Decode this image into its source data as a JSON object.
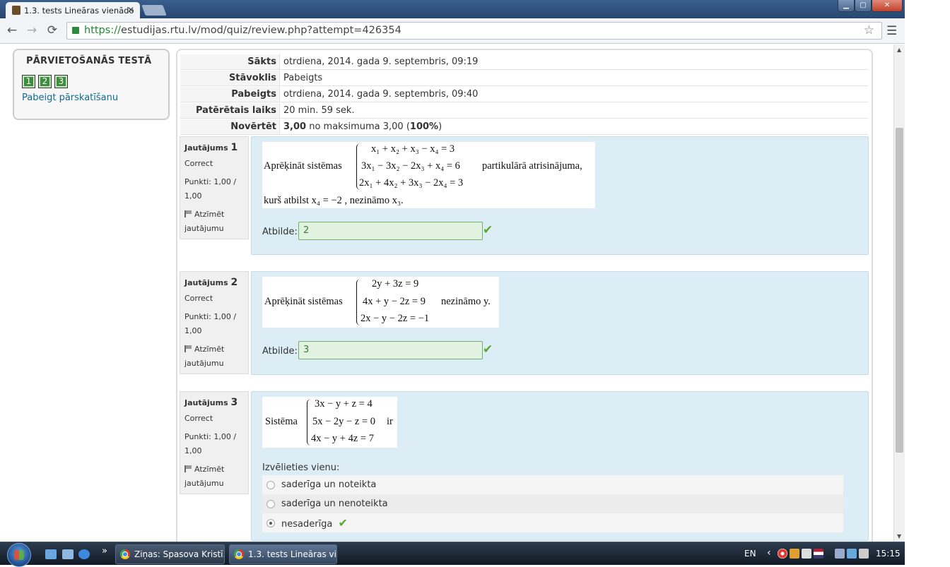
{
  "browser": {
    "tab_title": "1.3. tests Lineāras vienādo",
    "tab_close": "✕",
    "url_scheme": "https://",
    "url_rest": "estudijas.rtu.lv/mod/quiz/review.php?attempt=426354",
    "back_icon": "←",
    "forward_icon": "→",
    "reload_icon": "⟳",
    "star_icon": "☆",
    "menu_icon": "☰",
    "win_min": "▁",
    "win_max": "▢",
    "win_close": "✕"
  },
  "nav": {
    "title": "PĀRVIETOŠANĀS TESTĀ",
    "buttons": [
      "1",
      "2",
      "3"
    ],
    "finish_link": "Pabeigt pārskatīšanu"
  },
  "summary": [
    {
      "label": "Sākts",
      "value": "otrdiena, 2014. gada 9. septembris, 09:19"
    },
    {
      "label": "Stāvoklis",
      "value": "Pabeigts"
    },
    {
      "label": "Pabeigts",
      "value": "otrdiena, 2014. gada 9. septembris, 09:40"
    },
    {
      "label": "Patērētais laiks",
      "value": "20 min. 59 sek."
    },
    {
      "label": "Novērtēt",
      "value_bold1": "3,00",
      "value_mid": " no maksimuma 3,00 (",
      "value_bold2": "100%",
      "value_end": ")"
    }
  ],
  "questions": [
    {
      "heading": "Jautājums",
      "number": "1",
      "status": "Correct",
      "points": "Punkti: 1,00 /",
      "points2": "1,00",
      "flag": "Atzīmēt",
      "flag2": "jautājumu",
      "prompt": "Aprēķināt sistēmas",
      "eq": [
        "x₁ + x₂ + x₃ − x₄  = 3",
        "3x₁ − 3x₂ − 2x₃ + x₄  = 6",
        "2x₁ + 4x₂ + 3x₃ − 2x₄ = 3"
      ],
      "suffix": "partikulārā atrisinājuma,",
      "line2": "kurš atbilst  x₄ = −2 , nezināmo x₃.",
      "answer_label": "Atbilde:",
      "answer": "2"
    },
    {
      "heading": "Jautājums",
      "number": "2",
      "status": "Correct",
      "points": "Punkti: 1,00 /",
      "points2": "1,00",
      "flag": "Atzīmēt",
      "flag2": "jautājumu",
      "prompt": "Aprēķināt sistēmas",
      "eq": [
        "2y + 3z = 9",
        "4x + y − 2z = 9",
        "2x − y − 2z = −1"
      ],
      "suffix": "nezināmo y.",
      "answer_label": "Atbilde:",
      "answer": "3"
    },
    {
      "heading": "Jautājums",
      "number": "3",
      "status": "Correct",
      "points": "Punkti: 1,00 /",
      "points2": "1,00",
      "flag": "Atzīmēt",
      "flag2": "jautājumu",
      "prompt": "Sistēma",
      "eq": [
        "3x − y + z = 4",
        "5x − 2y − z = 0",
        "4x − y + 4z = 7"
      ],
      "suffix": "ir",
      "choose_label": "Izvēlieties vienu:",
      "options": [
        "saderīga un noteikta",
        "saderīga un nenoteikta",
        "nesaderīga"
      ],
      "selected_index": 2
    }
  ],
  "check_icon": "✔",
  "taskbar": {
    "tasks": [
      "Ziņas: Spasova Kristī...",
      "1.3. tests Lineāras vi..."
    ],
    "chevron": "»",
    "lang": "EN",
    "tray_arrow": "‹",
    "clock": "15:15"
  }
}
